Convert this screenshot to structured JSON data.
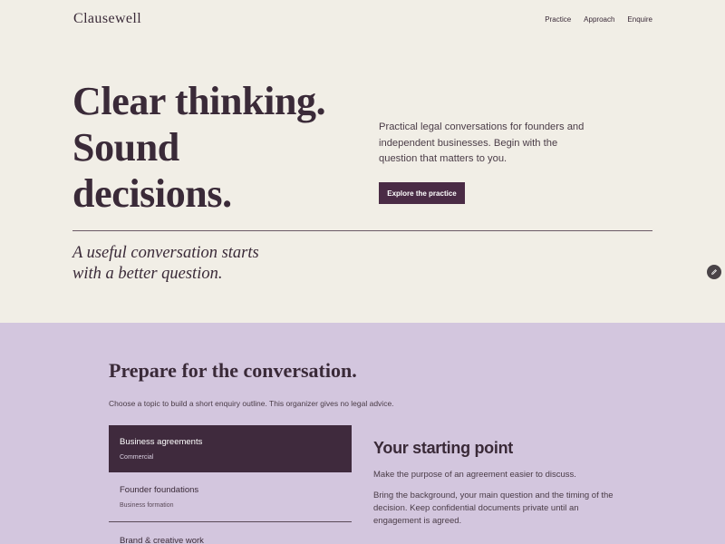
{
  "header": {
    "logo": "Clausewell",
    "nav": [
      "Practice",
      "Approach",
      "Enquire"
    ]
  },
  "hero": {
    "title_lines": [
      "Clear thinking.",
      "Sound",
      "decisions."
    ],
    "description": "Practical legal conversations for founders and independent businesses. Begin with the question that matters to you.",
    "cta_label": "Explore the practice",
    "tagline_lines": [
      "A useful conversation starts",
      "with a better question."
    ]
  },
  "organizer": {
    "title": "Prepare for the conversation.",
    "subtitle": "Choose a topic to build a short enquiry outline. This organizer gives no legal advice.",
    "topics": [
      {
        "title": "Business agreements",
        "category": "Commercial"
      },
      {
        "title": "Founder foundations",
        "category": "Business formation"
      },
      {
        "title": "Brand & creative work",
        "category": ""
      }
    ],
    "starting_point": {
      "title": "Your starting point",
      "lead": "Make the purpose of an agreement easier to discuss.",
      "body": "Bring the background, your main question and the timing of the decision. Keep confidential documents private until an engagement is agreed."
    }
  },
  "icons": {
    "edit_fab": "pencil-icon"
  },
  "colors": {
    "page_bg": "#f1eee6",
    "accent": "#4a2b45",
    "section_bg": "#d3c6de",
    "active_topic_bg": "#3f2a3d"
  }
}
